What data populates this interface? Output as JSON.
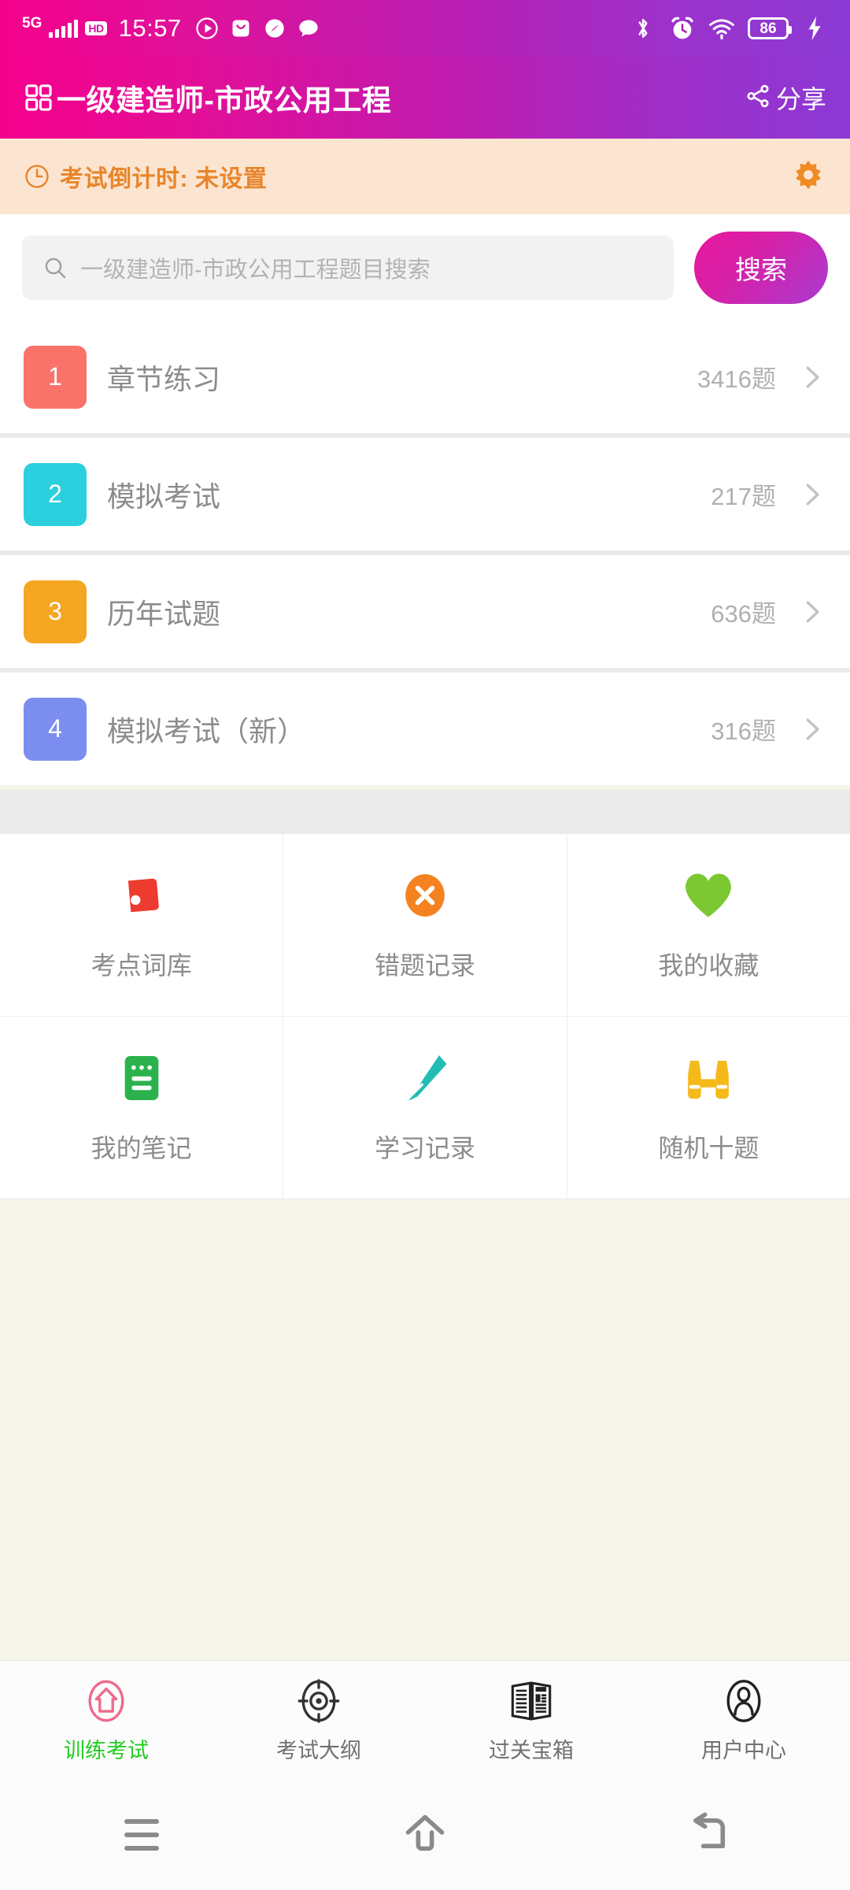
{
  "statusbar": {
    "network_type": "5G",
    "hd_badge": "HD",
    "time": "15:57",
    "icons_left": [
      "play-icon",
      "mail-icon",
      "compass-icon",
      "chat-icon"
    ],
    "icons_right": [
      "bluetooth-icon",
      "alarm-icon",
      "wifi-icon"
    ],
    "battery_level": "86",
    "charging": true
  },
  "titlebar": {
    "menu_icon": "grid-icon",
    "title": "一级建造师-市政公用工程",
    "share_label": "分享",
    "share_icon": "share-icon"
  },
  "countdown": {
    "clock_icon": "clock-icon",
    "text": "考试倒计时: 未设置",
    "settings_icon": "gear-icon",
    "accent_color": "#e8852c",
    "background_color": "#fce5d0"
  },
  "search": {
    "icon": "search-icon",
    "placeholder": "一级建造师-市政公用工程题目搜索",
    "value": "",
    "button_label": "搜索"
  },
  "list": {
    "items": [
      {
        "num": "1",
        "label": "章节练习",
        "count": "3416题",
        "color": "#f9736b",
        "chevron": "chevron-right-icon"
      },
      {
        "num": "2",
        "label": "模拟考试",
        "count": "217题",
        "color": "#2ccfdd",
        "chevron": "chevron-right-icon"
      },
      {
        "num": "3",
        "label": "历年试题",
        "count": "636题",
        "color": "#f5a623",
        "chevron": "chevron-right-icon"
      },
      {
        "num": "4",
        "label": "模拟考试（新）",
        "count": "316题",
        "color": "#7b8ef0",
        "chevron": "chevron-right-icon"
      }
    ]
  },
  "tools": {
    "rows": [
      [
        {
          "label": "考点词库",
          "icon": "tag-icon",
          "color": "#ee3b2f"
        },
        {
          "label": "错题记录",
          "icon": "x-circle-icon",
          "color": "#f58220"
        },
        {
          "label": "我的收藏",
          "icon": "heart-icon",
          "color": "#7bc832"
        }
      ],
      [
        {
          "label": "我的笔记",
          "icon": "notebook-icon",
          "color": "#2bb24c"
        },
        {
          "label": "学习记录",
          "icon": "pen-icon",
          "color": "#21bdb5"
        },
        {
          "label": "随机十题",
          "icon": "binoculars-icon",
          "color": "#f5b91a"
        }
      ]
    ]
  },
  "bottomnav": {
    "items": [
      {
        "label": "训练考试",
        "icon": "home-icon",
        "active": true
      },
      {
        "label": "考试大纲",
        "icon": "target-icon",
        "active": false
      },
      {
        "label": "过关宝箱",
        "icon": "book-icon",
        "active": false
      },
      {
        "label": "用户中心",
        "icon": "person-icon",
        "active": false
      }
    ],
    "active_color": "#22cc22"
  },
  "androidnav": {
    "recents_icon": "menu-icon",
    "home_icon": "home-arrow-icon",
    "back_icon": "back-arrow-icon"
  }
}
